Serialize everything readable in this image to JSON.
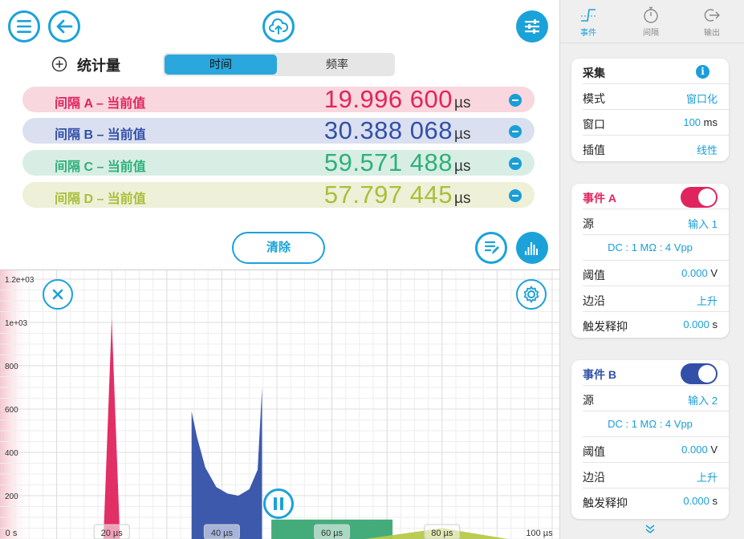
{
  "header": {
    "menu_icon": "menu-icon",
    "back_icon": "back-arrow-icon",
    "upload_icon": "cloud-upload-icon",
    "settings_icon": "sliders-icon"
  },
  "stats": {
    "title": "统计量",
    "segments": [
      {
        "label": "时间",
        "active": true
      },
      {
        "label": "频率",
        "active": false
      }
    ],
    "rows": [
      {
        "label": "间隔 A – 当前值",
        "value": "19.996 600",
        "unit": "µs",
        "color": "#e0245e",
        "bg": "#f8d7de"
      },
      {
        "label": "间隔 B – 当前值",
        "value": "30.388 068",
        "unit": "µs",
        "color": "#3250a8",
        "bg": "#dbe0f0"
      },
      {
        "label": "间隔 C – 当前值",
        "value": "59.571 488",
        "unit": "µs",
        "color": "#2fb07a",
        "bg": "#d8eee4"
      },
      {
        "label": "间隔 D – 当前值",
        "value": "57.797 445",
        "unit": "µs",
        "color": "#a9bf3a",
        "bg": "#eef0d8"
      }
    ],
    "clear_label": "清除"
  },
  "chart_data": {
    "type": "area",
    "title": "",
    "xlabel": "",
    "ylabel": "",
    "x_ticks": [
      "0 s",
      "20 µs",
      "40 µs",
      "60 µs",
      "80 µs",
      "100 µs"
    ],
    "y_ticks": [
      "200",
      "400",
      "600",
      "800",
      "1e+03",
      "1.2e+03"
    ],
    "xlim": [
      0,
      100
    ],
    "ylim": [
      0,
      1200
    ],
    "grid": true,
    "series": [
      {
        "color": "#e0245e",
        "x": [
          18.5,
          20,
          21.5
        ],
        "y": [
          0,
          1020,
          0
        ]
      },
      {
        "color": "#3250a8",
        "x": [
          34.5,
          34.5,
          35.5,
          37,
          39,
          41,
          43,
          45,
          46.5,
          47.3,
          47.3
        ],
        "y": [
          0,
          590,
          470,
          330,
          240,
          210,
          200,
          230,
          320,
          700,
          0
        ]
      },
      {
        "color": "#3aa874",
        "x": [
          49,
          49,
          71,
          71
        ],
        "y": [
          0,
          90,
          90,
          0
        ]
      },
      {
        "color": "#b8c84a",
        "x": [
          66,
          80,
          92
        ],
        "y": [
          0,
          50,
          0
        ]
      }
    ]
  },
  "chart_controls": {
    "close_icon": "close-icon",
    "gear_icon": "gear-icon",
    "pause_icon": "pause-icon",
    "notes_icon": "edit-notes-icon",
    "histogram_icon": "histogram-icon"
  },
  "tabs": [
    {
      "label": "事件",
      "icon": "edge-icon",
      "active": true
    },
    {
      "label": "间隔",
      "icon": "stopwatch-icon",
      "active": false
    },
    {
      "label": "输出",
      "icon": "output-icon",
      "active": false
    }
  ],
  "acquire": {
    "title": "采集",
    "rows": [
      {
        "key": "模式",
        "value": "窗口化",
        "unit": ""
      },
      {
        "key": "窗口",
        "value": "100",
        "unit": " ms"
      },
      {
        "key": "插值",
        "value": "线性",
        "unit": ""
      }
    ]
  },
  "event_a": {
    "title": "事件 A",
    "toggle_color": "#e0245e",
    "source_key": "源",
    "source_value": "输入 1",
    "coupling": "DC : 1 MΩ : 4 Vpp",
    "threshold_key": "阈值",
    "threshold_value": "0.000",
    "threshold_unit": " V",
    "edge_key": "边沿",
    "edge_value": "上升",
    "holdoff_key": "触发释抑",
    "holdoff_value": "0.000",
    "holdoff_unit": " s"
  },
  "event_b": {
    "title": "事件 B",
    "toggle_color": "#3250a8",
    "source_key": "源",
    "source_value": "输入 2",
    "coupling": "DC : 1 MΩ : 4 Vpp",
    "threshold_key": "阈值",
    "threshold_value": "0.000",
    "threshold_unit": " V",
    "edge_key": "边沿",
    "edge_value": "上升",
    "holdoff_key": "触发释抑",
    "holdoff_value": "0.000",
    "holdoff_unit": " s"
  },
  "colors": {
    "accent": "#1ba2d9"
  }
}
